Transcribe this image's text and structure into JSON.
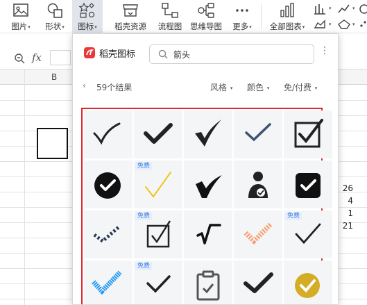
{
  "ribbon": {
    "items": [
      {
        "label": "图片",
        "icon": "image-icon"
      },
      {
        "label": "形状",
        "icon": "shapes-icon"
      },
      {
        "label": "图标",
        "icon": "icons-icon"
      },
      {
        "label": "稻壳资源",
        "icon": "resource-store-icon"
      },
      {
        "label": "流程图",
        "icon": "flowchart-icon"
      },
      {
        "label": "思维导图",
        "icon": "mindmap-icon"
      },
      {
        "label": "更多",
        "icon": "more-dots-icon"
      },
      {
        "label": "全部图表",
        "icon": "all-charts-icon"
      }
    ]
  },
  "formula_bar": {
    "fx": "fx"
  },
  "sheet": {
    "column_b": "B",
    "numbers": [
      "26",
      "4",
      "1",
      "21"
    ]
  },
  "panel": {
    "brand": "稻壳图标",
    "search_value": "箭头",
    "results": "59个结果",
    "filters": [
      "风格",
      "颜色",
      "免/付费"
    ],
    "free_tag": "免费",
    "accent_color": "#e0252e"
  }
}
